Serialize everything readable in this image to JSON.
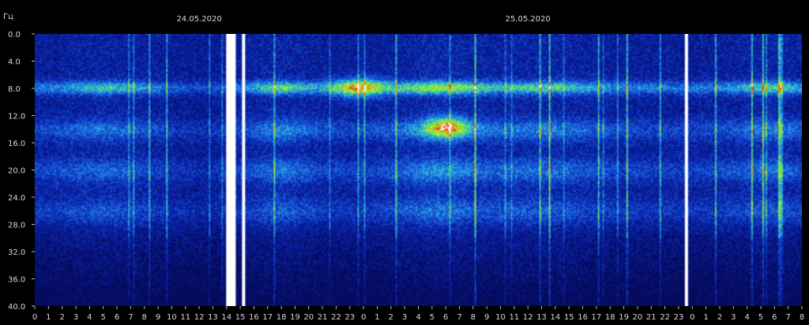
{
  "chart_data": {
    "type": "heatmap",
    "title": "",
    "ylabel": "Гц",
    "xlabel": "",
    "ylim": [
      0,
      40
    ],
    "y_ticks": [
      "0.0",
      "4.0",
      "8.0",
      "12.0",
      "16.0",
      "20.0",
      "24.0",
      "28.0",
      "32.0",
      "36.0",
      "40.0"
    ],
    "x_ticks": [
      "0",
      "1",
      "2",
      "3",
      "4",
      "5",
      "6",
      "7",
      "8",
      "9",
      "10",
      "11",
      "12",
      "13",
      "14",
      "15",
      "16",
      "17",
      "18",
      "19",
      "20",
      "21",
      "22",
      "23",
      "0",
      "1",
      "2",
      "3",
      "4",
      "5",
      "6",
      "7",
      "8",
      "9",
      "10",
      "11",
      "12",
      "13",
      "14",
      "15",
      "16",
      "17",
      "18",
      "19",
      "20",
      "21",
      "22",
      "23",
      "0",
      "1",
      "2",
      "3",
      "4",
      "5",
      "6",
      "7",
      "8"
    ],
    "dates": [
      "24.05.2020",
      "25.05.2020"
    ],
    "colors": {
      "background": "#000000",
      "low": "#0a1c9c",
      "mid": "#2ea0e0",
      "high": "#7cf03c",
      "peak": "#e8301c",
      "max": "#ffffff",
      "frame": "#000000"
    },
    "bands_hz": [
      7.8,
      14.0,
      20.0,
      26.0
    ],
    "features": [
      {
        "kind": "saturation-column",
        "hour_index": 14.3,
        "width_h": 0.6
      },
      {
        "kind": "saturation-column",
        "hour_index": 15.2,
        "width_h": 0.2
      },
      {
        "kind": "saturation-column",
        "hour_index": 47.5,
        "width_h": 0.15
      },
      {
        "kind": "hot-spot",
        "hour_index": 23.6,
        "hz": 7.8,
        "spread_h": 2.0
      },
      {
        "kind": "hot-spot",
        "hour_index": 30.0,
        "hz": 13.5,
        "spread_h": 1.5
      }
    ]
  }
}
